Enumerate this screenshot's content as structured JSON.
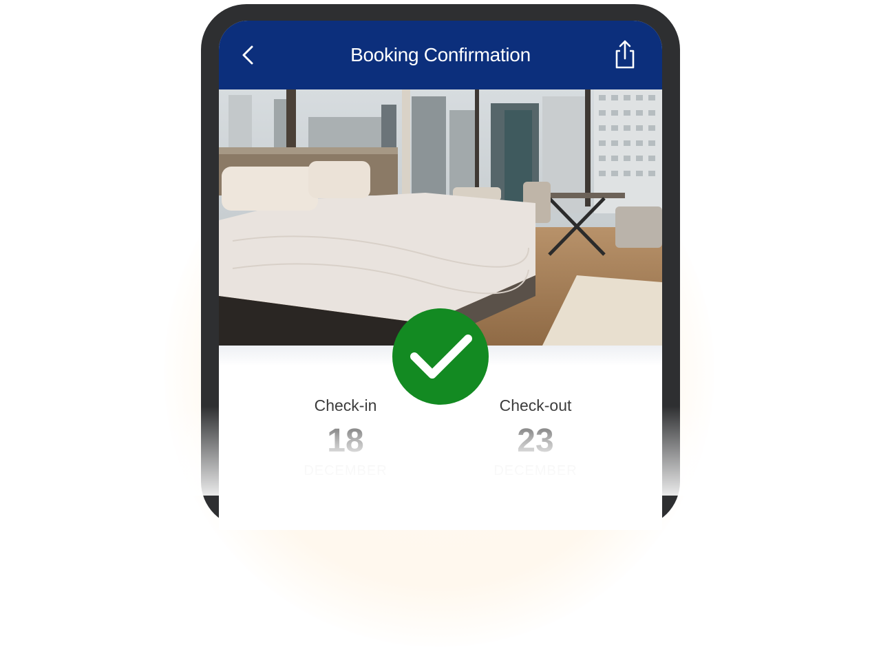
{
  "app": {
    "title": "Booking Confirmation",
    "back_icon": "chevron-left-icon",
    "share_icon": "share-icon",
    "header_color": "#0c2f7c"
  },
  "hero": {
    "image": "hotel-room-city-view",
    "status_icon": "checkmark-icon",
    "status_color": "#138a22"
  },
  "stay": {
    "check_in": {
      "label": "Check-in",
      "day": "18",
      "month": "DECEMBER"
    },
    "check_out": {
      "label": "Check-out",
      "day": "23",
      "month": "DECEMBER"
    }
  }
}
